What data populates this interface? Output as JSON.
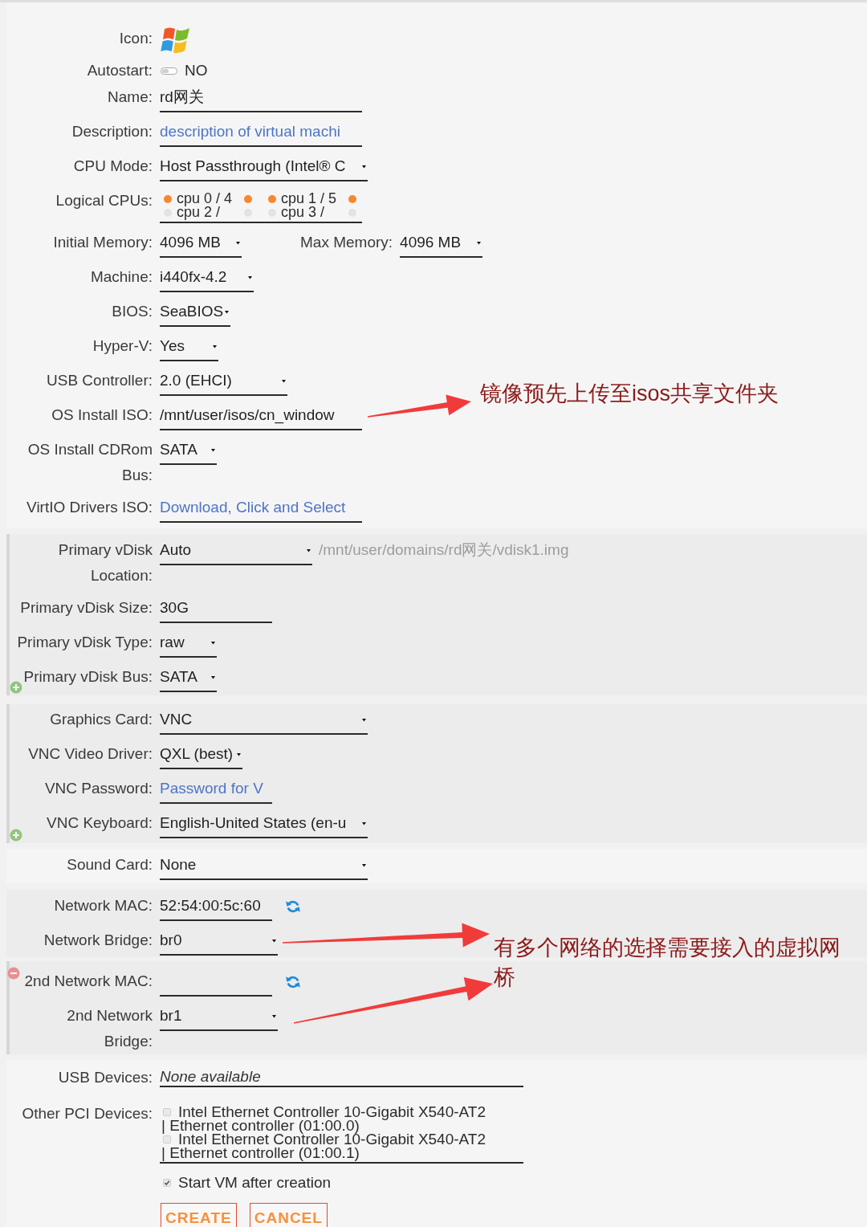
{
  "sections": [
    {
      "rows": [
        {
          "kind": "logo",
          "label": "Icon:"
        },
        {
          "kind": "toggle",
          "label": "Autostart:",
          "on": false,
          "value": "NO"
        },
        {
          "kind": "input",
          "label": "Name:",
          "value": "rd网关"
        },
        {
          "kind": "input",
          "label": "Description:",
          "placeholder": "description of virtual machi"
        },
        {
          "kind": "select",
          "label": "CPU Mode:",
          "value": "Host Passthrough (Intel® C"
        },
        {
          "kind": "cpus",
          "label": "Logical CPUs:",
          "cpus": [
            {
              "label": "cpu 0 / 4",
              "boxes": [
                {
                  "checked": true
                },
                {
                  "checked": true
                }
              ]
            },
            {
              "label": "cpu 1 / 5",
              "boxes": [
                {
                  "checked": true
                },
                {
                  "checked": true
                }
              ]
            },
            {
              "label": "cpu 2 /",
              "boxes": [
                {
                  "checked": false
                },
                {
                  "checked": false
                }
              ]
            },
            {
              "label": "cpu 3 /",
              "boxes": [
                {
                  "checked": false
                },
                {
                  "checked": false
                }
              ]
            }
          ]
        },
        {
          "kind": "select",
          "label": "Initial Memory:",
          "value": "4096 MB",
          "second": {
            "label": "Max Memory:",
            "value": "4096 MB"
          }
        },
        {
          "kind": "select",
          "label": "Machine:",
          "value": "i440fx-4.2"
        },
        {
          "kind": "select",
          "label": "BIOS:",
          "value": "SeaBIOS"
        },
        {
          "kind": "select",
          "label": "Hyper-V:",
          "value": "Yes"
        },
        {
          "kind": "select",
          "label": "USB Controller:",
          "value": "2.0 (EHCI)"
        },
        {
          "kind": "input",
          "label": "OS Install ISO:",
          "value": "/mnt/user/isos/cn_window"
        },
        {
          "kind": "select",
          "label": "OS Install CDRom Bus:",
          "value": "SATA"
        },
        {
          "kind": "input",
          "label": "VirtIO Drivers ISO:",
          "placeholder": "Download, Click and Select"
        }
      ]
    },
    {
      "addable": true,
      "rows": [
        {
          "kind": "select",
          "label": "Primary vDisk Location:",
          "value": "Auto",
          "hint": "/mnt/user/domains/rd网关/vdisk1.img"
        },
        {
          "kind": "input",
          "label": "Primary vDisk Size:",
          "value": "30G"
        },
        {
          "kind": "select",
          "label": "Primary vDisk Type:",
          "value": "raw"
        },
        {
          "kind": "select",
          "label": "Primary vDisk Bus:",
          "value": "SATA"
        }
      ]
    },
    {
      "addable": true,
      "rows": [
        {
          "kind": "select",
          "label": "Graphics Card:",
          "value": "VNC"
        },
        {
          "kind": "select",
          "label": "VNC Video Driver:",
          "value": "QXL (best)"
        },
        {
          "kind": "input",
          "label": "VNC Password:",
          "placeholder": "Password for V"
        },
        {
          "kind": "select",
          "label": "VNC Keyboard:",
          "value": "English-United States (en-u"
        }
      ]
    },
    {
      "rows": [
        {
          "kind": "select",
          "label": "Sound Card:",
          "value": "None"
        }
      ]
    },
    {
      "rows": [
        {
          "kind": "mac",
          "label": "Network MAC:",
          "value": "52:54:00:5c:60"
        },
        {
          "kind": "select",
          "label": "Network Bridge:",
          "value": "br0"
        }
      ]
    },
    {
      "removable": true,
      "rows": [
        {
          "kind": "mac",
          "label": "2nd Network MAC:"
        },
        {
          "kind": "select",
          "label": "2nd Network Bridge:",
          "value": "br1"
        }
      ]
    },
    {
      "rows": [
        {
          "kind": "static",
          "label": "USB Devices:",
          "value": "None available"
        },
        {
          "kind": "devices",
          "label": "Other PCI Devices:",
          "devices": [
            {
              "name": "Intel Ethernet Controller 10-Gigabit X540-AT2",
              "detail": "| Ethernet controller (01:00.0)",
              "checked": false
            },
            {
              "name": "Intel Ethernet Controller 10-Gigabit X540-AT2",
              "detail": "| Ethernet controller (01:00.1)",
              "checked": false
            }
          ]
        },
        {
          "kind": "checkbox",
          "text": "Start VM after creation",
          "checked": true
        },
        {
          "kind": "buttons",
          "buttons": [
            "CREATE",
            "CANCEL"
          ]
        }
      ]
    }
  ],
  "annotations": [
    {
      "text": "镜像预先上传至isos共享文件夹"
    },
    {
      "text": "有多个网络的选择需要接入的虚拟网桥"
    }
  ]
}
